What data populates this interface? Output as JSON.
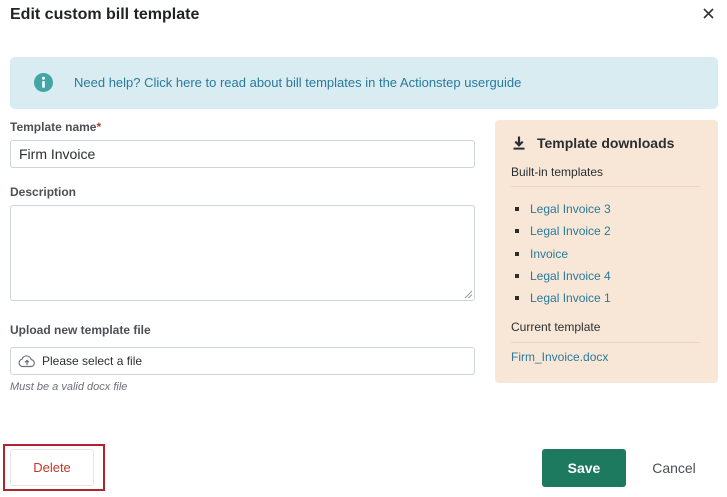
{
  "dialog": {
    "title": "Edit custom bill template",
    "close_icon": "close-icon"
  },
  "help": {
    "icon": "info-icon",
    "text": "Need help? Click here to read about bill templates in the Actionstep userguide"
  },
  "form": {
    "template_name_label": "Template name",
    "required_marker": "*",
    "template_name_value": "Firm Invoice",
    "description_label": "Description",
    "description_value": "",
    "upload_label": "Upload new template file",
    "upload_icon": "cloud-upload-icon",
    "upload_placeholder": "Please select a file",
    "upload_hint": "Must be a valid docx file"
  },
  "downloads": {
    "icon": "download-icon",
    "title": "Template downloads",
    "builtin_label": "Built-in templates",
    "builtin_templates": [
      "Legal Invoice 3",
      "Legal Invoice 2",
      "Invoice",
      "Legal Invoice 4",
      "Legal Invoice 1"
    ],
    "current_label": "Current template",
    "current_file": "Firm_Invoice.docx"
  },
  "actions": {
    "delete_label": "Delete",
    "save_label": "Save",
    "cancel_label": "Cancel"
  },
  "colors": {
    "accent_green": "#1e7a5f",
    "link_blue": "#2a7a9c",
    "delete_red": "#c0392b",
    "help_bg": "#d9ecf2",
    "panel_bg": "#f8e7d6"
  }
}
